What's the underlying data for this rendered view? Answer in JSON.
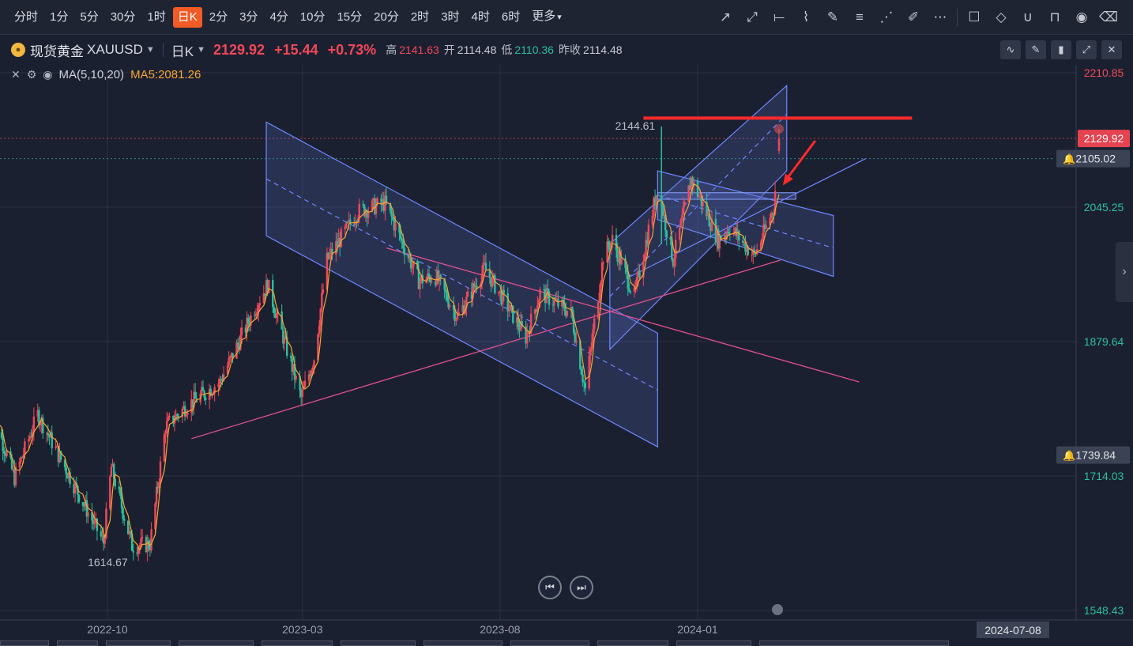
{
  "toolbar": {
    "timeframes": [
      "分时",
      "1分",
      "5分",
      "30分",
      "1时",
      "日K",
      "2分",
      "3分",
      "4分",
      "10分",
      "15分",
      "20分",
      "2时",
      "3时",
      "4时",
      "6时",
      "更多"
    ],
    "active_timeframe": "日K",
    "tool_icons": [
      "trend-line-icon",
      "ray-icon",
      "horizontal-line-icon",
      "polyline-icon",
      "pen-icon",
      "fibonacci-icon",
      "fan-icon",
      "highlighter-icon",
      "more-dots-icon",
      "note-icon",
      "eraser-icon",
      "magnet-icon",
      "unlock-icon",
      "eye-icon",
      "trash-icon"
    ]
  },
  "quote": {
    "name": "现货黄金",
    "code": "XAUUSD",
    "period": "日K",
    "last": "2129.92",
    "change": "+15.44",
    "change_pct": "+0.73%",
    "high_label": "高",
    "high": "2141.63",
    "open_label": "开",
    "open": "2114.48",
    "low_label": "低",
    "low": "2110.36",
    "prev_label": "昨收",
    "prev": "2114.48",
    "up_color": "#f0485a",
    "down_color": "#2bbf9b"
  },
  "indicator": {
    "name": "MA(5,10,20)",
    "ma5": "MA5:2081.26",
    "ma5_color": "#f5a634"
  },
  "chart_data": {
    "type": "candlestick",
    "title": "现货黄金 XAUUSD 日K",
    "x_tick_labels": [
      "2022-10",
      "2023-03",
      "2023-08",
      "2024-01"
    ],
    "crosshair_date": "2024-07-08",
    "y_tick_labels": [
      "2210.85",
      "2045.25",
      "1879.64",
      "1714.03",
      "1548.43"
    ],
    "ylim": [
      1548.43,
      2210.85
    ],
    "last_price_tag": "2129.92",
    "alert_levels": [
      "2105.02",
      "1739.84"
    ],
    "annotations": {
      "high_marker": "2144.61",
      "low_marker": "1614.67"
    },
    "close_path": [
      [
        "2022-07-01",
        1807
      ],
      [
        "2022-07-21",
        1712
      ],
      [
        "2022-08-08",
        1790
      ],
      [
        "2022-08-30",
        1722
      ],
      [
        "2022-09-28",
        1632
      ],
      [
        "2022-10-04",
        1725
      ],
      [
        "2022-10-20",
        1628
      ],
      [
        "2022-11-03",
        1630
      ],
      [
        "2022-11-15",
        1775
      ],
      [
        "2022-12-01",
        1800
      ],
      [
        "2022-12-27",
        1830
      ],
      [
        "2023-01-26",
        1930
      ],
      [
        "2023-02-02",
        1950
      ],
      [
        "2023-02-28",
        1810
      ],
      [
        "2023-03-10",
        1860
      ],
      [
        "2023-03-20",
        1980
      ],
      [
        "2023-04-13",
        2040
      ],
      [
        "2023-05-04",
        2050
      ],
      [
        "2023-05-30",
        1955
      ],
      [
        "2023-06-12",
        1960
      ],
      [
        "2023-06-29",
        1910
      ],
      [
        "2023-07-20",
        1970
      ],
      [
        "2023-08-21",
        1885
      ],
      [
        "2023-09-01",
        1940
      ],
      [
        "2023-09-25",
        1915
      ],
      [
        "2023-10-06",
        1820
      ],
      [
        "2023-10-20",
        1985
      ],
      [
        "2023-10-27",
        2005
      ],
      [
        "2023-11-13",
        1935
      ],
      [
        "2023-12-01",
        2070
      ],
      [
        "2023-12-13",
        1980
      ],
      [
        "2023-12-27",
        2080
      ],
      [
        "2024-01-17",
        2005
      ],
      [
        "2024-01-26",
        2020
      ],
      [
        "2024-02-14",
        1985
      ],
      [
        "2024-02-29",
        2045
      ],
      [
        "2024-03-04",
        2129.92
      ]
    ],
    "drawings": {
      "red_horizontal_level": "~2155",
      "channels": [
        "descending channel Mar–Oct 2023",
        "ascending channel Oct–Dec 2023",
        "small descending channel Dec 2023–Mar 2024"
      ],
      "trendlines": [
        "pink support line from Nov 2022",
        "pink resistance line from May 2023",
        "blue rising line",
        "red arrow to latest candle"
      ]
    }
  }
}
